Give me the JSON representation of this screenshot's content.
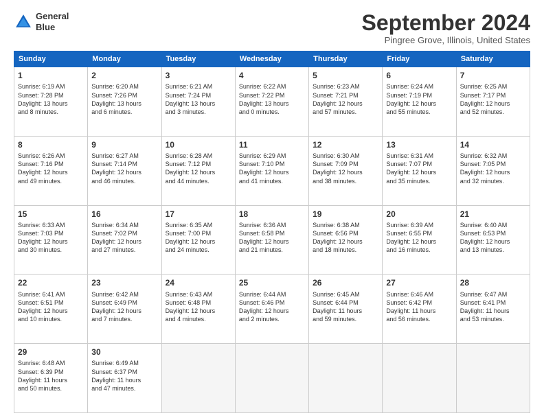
{
  "header": {
    "logo_line1": "General",
    "logo_line2": "Blue",
    "title": "September 2024",
    "location": "Pingree Grove, Illinois, United States"
  },
  "days_of_week": [
    "Sunday",
    "Monday",
    "Tuesday",
    "Wednesday",
    "Thursday",
    "Friday",
    "Saturday"
  ],
  "weeks": [
    [
      {
        "num": "1",
        "info": "Sunrise: 6:19 AM\nSunset: 7:28 PM\nDaylight: 13 hours\nand 8 minutes."
      },
      {
        "num": "2",
        "info": "Sunrise: 6:20 AM\nSunset: 7:26 PM\nDaylight: 13 hours\nand 6 minutes."
      },
      {
        "num": "3",
        "info": "Sunrise: 6:21 AM\nSunset: 7:24 PM\nDaylight: 13 hours\nand 3 minutes."
      },
      {
        "num": "4",
        "info": "Sunrise: 6:22 AM\nSunset: 7:22 PM\nDaylight: 13 hours\nand 0 minutes."
      },
      {
        "num": "5",
        "info": "Sunrise: 6:23 AM\nSunset: 7:21 PM\nDaylight: 12 hours\nand 57 minutes."
      },
      {
        "num": "6",
        "info": "Sunrise: 6:24 AM\nSunset: 7:19 PM\nDaylight: 12 hours\nand 55 minutes."
      },
      {
        "num": "7",
        "info": "Sunrise: 6:25 AM\nSunset: 7:17 PM\nDaylight: 12 hours\nand 52 minutes."
      }
    ],
    [
      {
        "num": "8",
        "info": "Sunrise: 6:26 AM\nSunset: 7:16 PM\nDaylight: 12 hours\nand 49 minutes."
      },
      {
        "num": "9",
        "info": "Sunrise: 6:27 AM\nSunset: 7:14 PM\nDaylight: 12 hours\nand 46 minutes."
      },
      {
        "num": "10",
        "info": "Sunrise: 6:28 AM\nSunset: 7:12 PM\nDaylight: 12 hours\nand 44 minutes."
      },
      {
        "num": "11",
        "info": "Sunrise: 6:29 AM\nSunset: 7:10 PM\nDaylight: 12 hours\nand 41 minutes."
      },
      {
        "num": "12",
        "info": "Sunrise: 6:30 AM\nSunset: 7:09 PM\nDaylight: 12 hours\nand 38 minutes."
      },
      {
        "num": "13",
        "info": "Sunrise: 6:31 AM\nSunset: 7:07 PM\nDaylight: 12 hours\nand 35 minutes."
      },
      {
        "num": "14",
        "info": "Sunrise: 6:32 AM\nSunset: 7:05 PM\nDaylight: 12 hours\nand 32 minutes."
      }
    ],
    [
      {
        "num": "15",
        "info": "Sunrise: 6:33 AM\nSunset: 7:03 PM\nDaylight: 12 hours\nand 30 minutes."
      },
      {
        "num": "16",
        "info": "Sunrise: 6:34 AM\nSunset: 7:02 PM\nDaylight: 12 hours\nand 27 minutes."
      },
      {
        "num": "17",
        "info": "Sunrise: 6:35 AM\nSunset: 7:00 PM\nDaylight: 12 hours\nand 24 minutes."
      },
      {
        "num": "18",
        "info": "Sunrise: 6:36 AM\nSunset: 6:58 PM\nDaylight: 12 hours\nand 21 minutes."
      },
      {
        "num": "19",
        "info": "Sunrise: 6:38 AM\nSunset: 6:56 PM\nDaylight: 12 hours\nand 18 minutes."
      },
      {
        "num": "20",
        "info": "Sunrise: 6:39 AM\nSunset: 6:55 PM\nDaylight: 12 hours\nand 16 minutes."
      },
      {
        "num": "21",
        "info": "Sunrise: 6:40 AM\nSunset: 6:53 PM\nDaylight: 12 hours\nand 13 minutes."
      }
    ],
    [
      {
        "num": "22",
        "info": "Sunrise: 6:41 AM\nSunset: 6:51 PM\nDaylight: 12 hours\nand 10 minutes."
      },
      {
        "num": "23",
        "info": "Sunrise: 6:42 AM\nSunset: 6:49 PM\nDaylight: 12 hours\nand 7 minutes."
      },
      {
        "num": "24",
        "info": "Sunrise: 6:43 AM\nSunset: 6:48 PM\nDaylight: 12 hours\nand 4 minutes."
      },
      {
        "num": "25",
        "info": "Sunrise: 6:44 AM\nSunset: 6:46 PM\nDaylight: 12 hours\nand 2 minutes."
      },
      {
        "num": "26",
        "info": "Sunrise: 6:45 AM\nSunset: 6:44 PM\nDaylight: 11 hours\nand 59 minutes."
      },
      {
        "num": "27",
        "info": "Sunrise: 6:46 AM\nSunset: 6:42 PM\nDaylight: 11 hours\nand 56 minutes."
      },
      {
        "num": "28",
        "info": "Sunrise: 6:47 AM\nSunset: 6:41 PM\nDaylight: 11 hours\nand 53 minutes."
      }
    ],
    [
      {
        "num": "29",
        "info": "Sunrise: 6:48 AM\nSunset: 6:39 PM\nDaylight: 11 hours\nand 50 minutes."
      },
      {
        "num": "30",
        "info": "Sunrise: 6:49 AM\nSunset: 6:37 PM\nDaylight: 11 hours\nand 47 minutes."
      },
      {
        "num": "",
        "info": ""
      },
      {
        "num": "",
        "info": ""
      },
      {
        "num": "",
        "info": ""
      },
      {
        "num": "",
        "info": ""
      },
      {
        "num": "",
        "info": ""
      }
    ]
  ]
}
